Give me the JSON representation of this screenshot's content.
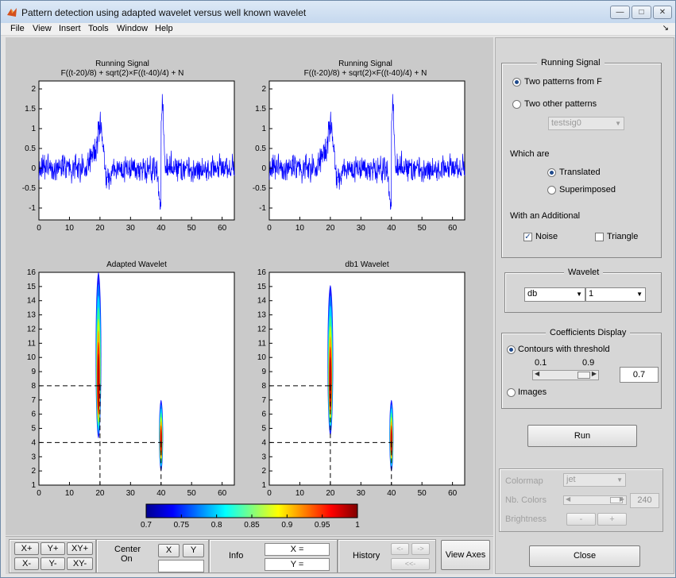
{
  "window": {
    "title": "Pattern detection using adapted wavelet versus well known wavelet",
    "controls": [
      "minimize-icon",
      "maximize-icon",
      "close-icon"
    ]
  },
  "menu": [
    "File",
    "View",
    "Insert",
    "Tools",
    "Window",
    "Help"
  ],
  "plots": {
    "top_left": {
      "title1": "Running Signal",
      "title2": "F((t-20)/8) + sqrt(2)×F((t-40)/4) + N"
    },
    "top_right": {
      "title1": "Running Signal",
      "title2": "F((t-20)/8) + sqrt(2)×F((t-40)/4) + N"
    },
    "bottom_left": {
      "title1": "Adapted Wavelet"
    },
    "bottom_right": {
      "title1": "db1 Wavelet"
    },
    "signal_xticks": [
      "0",
      "10",
      "20",
      "30",
      "40",
      "50",
      "60"
    ],
    "signal_yticks": [
      "2",
      "1.5",
      "1",
      "0.5",
      "0",
      "-0.5",
      "-1"
    ],
    "coef_xticks": [
      "0",
      "10",
      "20",
      "30",
      "40",
      "50",
      "60"
    ],
    "coef_yticks": [
      "16",
      "15",
      "14",
      "13",
      "12",
      "11",
      "10",
      "9",
      "8",
      "7",
      "6",
      "5",
      "4",
      "3",
      "2",
      "1"
    ],
    "colorbar_ticks": [
      "0.7",
      "0.75",
      "0.8",
      "0.85",
      "0.9",
      "0.95",
      "1"
    ]
  },
  "chart_data": [
    {
      "type": "line",
      "title": "Running Signal",
      "subtitle": "F((t-20)/8) + sqrt(2)×F((t-40)/4) + N",
      "xlim": [
        0,
        64
      ],
      "ylim": [
        -1.3,
        2.2
      ],
      "features": [
        {
          "x": 20.3,
          "y": 1.7
        },
        {
          "x": 40,
          "y": -1.25
        },
        {
          "x": 40.7,
          "y": 2.0
        }
      ]
    },
    {
      "type": "line",
      "title": "Running Signal",
      "subtitle": "F((t-20)/8) + sqrt(2)×F((t-40)/4) + N",
      "xlim": [
        0,
        64
      ],
      "ylim": [
        -1.3,
        2.2
      ],
      "features": [
        {
          "x": 20.3,
          "y": 1.7
        },
        {
          "x": 40,
          "y": -1.25
        },
        {
          "x": 40.7,
          "y": 2.0
        }
      ]
    },
    {
      "type": "heatmap",
      "title": "Adapted Wavelet",
      "xlim": [
        0,
        64
      ],
      "ylim": [
        1,
        16
      ],
      "markers": [
        {
          "x": 20,
          "y": 8
        },
        {
          "x": 40,
          "y": 4
        }
      ],
      "blobs": [
        {
          "cx": 19.5,
          "y_range": [
            4.3,
            16
          ],
          "peak_y": 8
        },
        {
          "cx": 40,
          "y_range": [
            2,
            7
          ],
          "peak_y": 4
        }
      ]
    },
    {
      "type": "heatmap",
      "title": "db1 Wavelet",
      "xlim": [
        0,
        64
      ],
      "ylim": [
        1,
        16
      ],
      "markers": [
        {
          "x": 20,
          "y": 8
        },
        {
          "x": 40,
          "y": 4
        }
      ],
      "blobs": [
        {
          "cx": 20,
          "y_range": [
            4.5,
            15.1
          ],
          "peak_y": 8
        },
        {
          "cx": 40,
          "y_range": [
            2,
            7
          ],
          "peak_y": 4
        }
      ]
    }
  ],
  "panel": {
    "running_signal": {
      "legend": "Running Signal",
      "two_patterns": "Two patterns from F",
      "other_patterns": "Two other patterns",
      "pattern_select": "testsig0",
      "which_are": "Which are",
      "translated": "Translated",
      "superimposed": "Superimposed",
      "additional": "With an Additional",
      "noise": "Noise",
      "triangle": "Triangle"
    },
    "wavelet": {
      "legend": "Wavelet",
      "family": "db",
      "number": "1"
    },
    "coefficients": {
      "legend": "Coefficients Display",
      "contours": "Contours with threshold",
      "low": "0.1",
      "high": "0.9",
      "threshold": "0.7",
      "images": "Images"
    },
    "run": "Run",
    "colormap": {
      "label": "Colormap",
      "value": "jet",
      "nb_label": "Nb. Colors",
      "nb_value": "240",
      "brightness_label": "Brightness",
      "minus": "-",
      "plus": "+"
    },
    "close": "Close"
  },
  "bottom": {
    "xplus": "X+",
    "yplus": "Y+",
    "xyplus": "XY+",
    "xminus": "X-",
    "yminus": "Y-",
    "xyminus": "XY-",
    "center": "Center",
    "on": "On",
    "x": "X",
    "y": "Y",
    "info": "Info",
    "xeq": "X =",
    "yeq": "Y =",
    "history": "History",
    "back": "<-",
    "fwd": "->",
    "first": "<<-",
    "view_axes": "View Axes"
  }
}
